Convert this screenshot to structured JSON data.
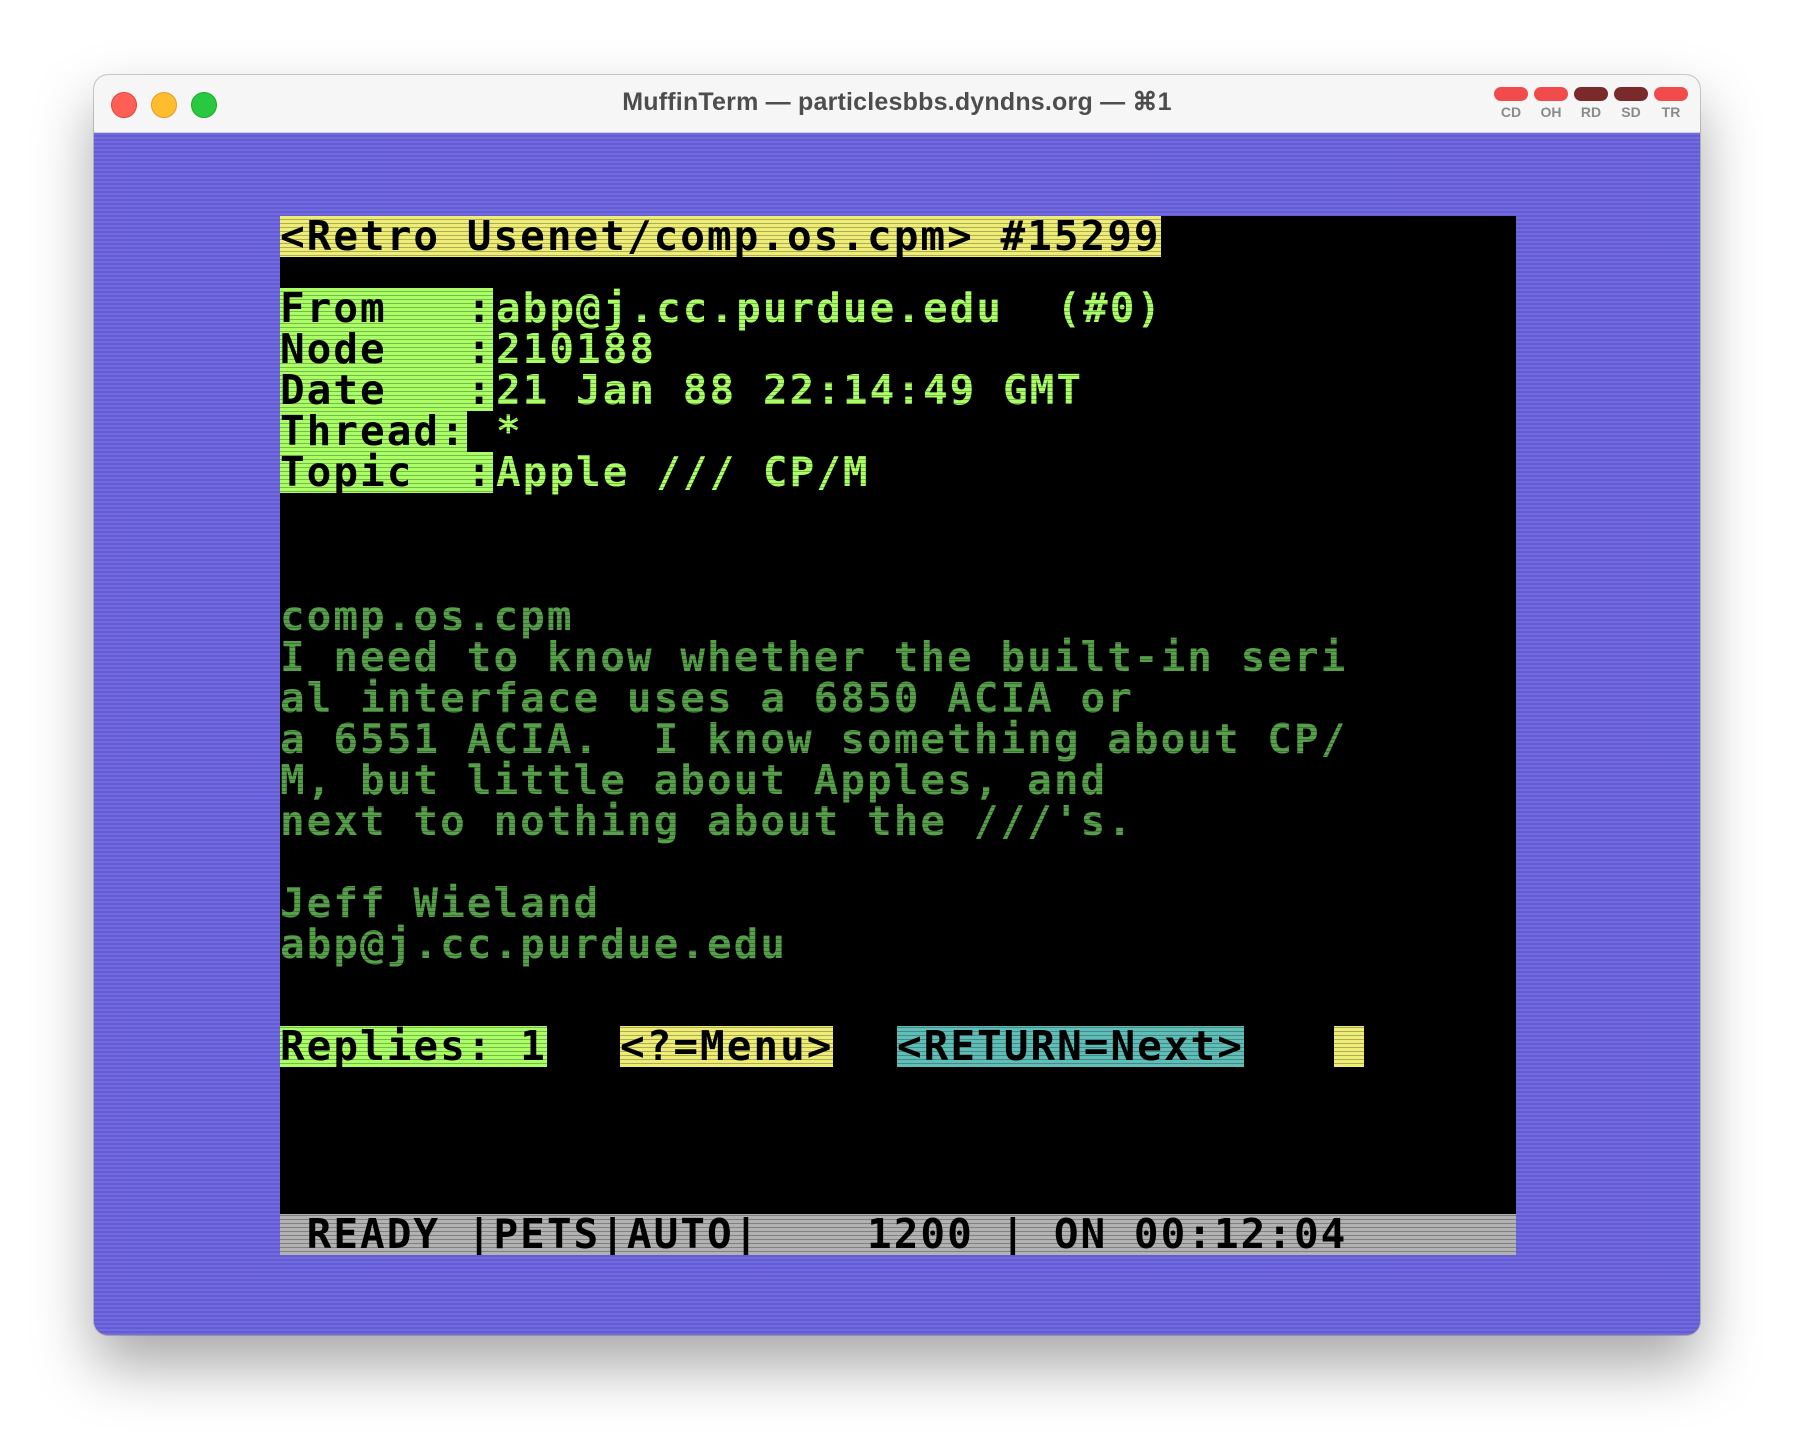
{
  "window": {
    "title": "MuffinTerm — particlesbbs.dyndns.org — ⌘1"
  },
  "leds": [
    {
      "label": "CD",
      "color": "#f24b4b"
    },
    {
      "label": "OH",
      "color": "#f24b4b"
    },
    {
      "label": "RD",
      "color": "#7a2a2a"
    },
    {
      "label": "SD",
      "color": "#7a2a2a"
    },
    {
      "label": "TR",
      "color": "#f24b4b"
    }
  ],
  "terminal": {
    "header": "<Retro Usenet/comp.os.cpm> #15299",
    "fields": [
      {
        "label": "From   :",
        "value": "abp@j.cc.purdue.edu  (#0)"
      },
      {
        "label": "Node   :",
        "value": "210188"
      },
      {
        "label": "Date   :",
        "value": "21 Jan 88 22:14:49 GMT"
      },
      {
        "label": "Thread:",
        "value": "*"
      },
      {
        "label": "Topic  :",
        "value": "Apple /// CP/M"
      }
    ],
    "body": [
      "comp.os.cpm",
      "I need to know whether the built-in seri",
      "al interface uses a 6850 ACIA or",
      "a 6551 ACIA.  I know something about CP/",
      "M, but little about Apples, and",
      "next to nothing about the ///'s."
    ],
    "signature": [
      "Jeff Wieland",
      "abp@j.cc.purdue.edu"
    ],
    "prompt": {
      "replies": "Replies: 1",
      "menu": "<?=Menu>",
      "next": "<RETURN=Next>"
    },
    "status": " READY |PETS|AUTO|    1200 | ON 00:12:04"
  },
  "colors": {
    "border": "#6b63e0",
    "header_bg": "#eeee77",
    "label_bg": "#aaff66",
    "body_text": "#55a049",
    "next_bg": "#5fbfb8",
    "status_bg": "#b2b2b2"
  }
}
